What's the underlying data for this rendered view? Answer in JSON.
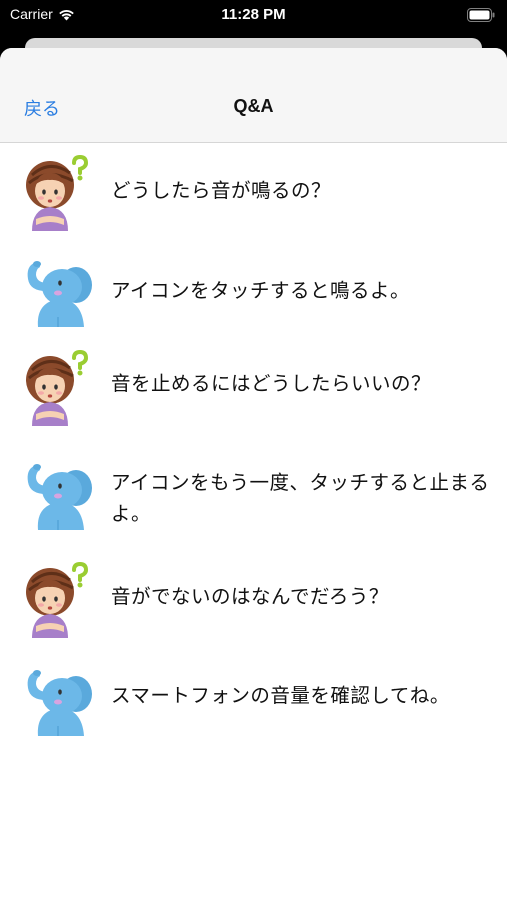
{
  "status_bar": {
    "carrier": "Carrier",
    "time": "11:28 PM"
  },
  "nav": {
    "back_label": "戻る",
    "title": "Q&A"
  },
  "colors": {
    "accent": "#2a7de1",
    "woman_shirt": "#a77fc9",
    "elephant": "#6cb8e8",
    "question_mark": "#9acd32"
  },
  "qa_items": [
    {
      "speaker": "woman",
      "icon": "woman-question-icon",
      "text": "どうしたら音が鳴るの？"
    },
    {
      "speaker": "elephant",
      "icon": "elephant-icon",
      "text": "アイコンをタッチすると鳴るよ。"
    },
    {
      "speaker": "woman",
      "icon": "woman-question-icon",
      "text": "音を止めるにはどうしたらいいの？"
    },
    {
      "speaker": "elephant",
      "icon": "elephant-icon",
      "text": "アイコンをもう一度、タッチすると止まるよ。"
    },
    {
      "speaker": "woman",
      "icon": "woman-question-icon",
      "text": "音がでないのはなんでだろう？"
    },
    {
      "speaker": "elephant",
      "icon": "elephant-icon",
      "text": "スマートフォンの音量を確認してね。"
    }
  ]
}
